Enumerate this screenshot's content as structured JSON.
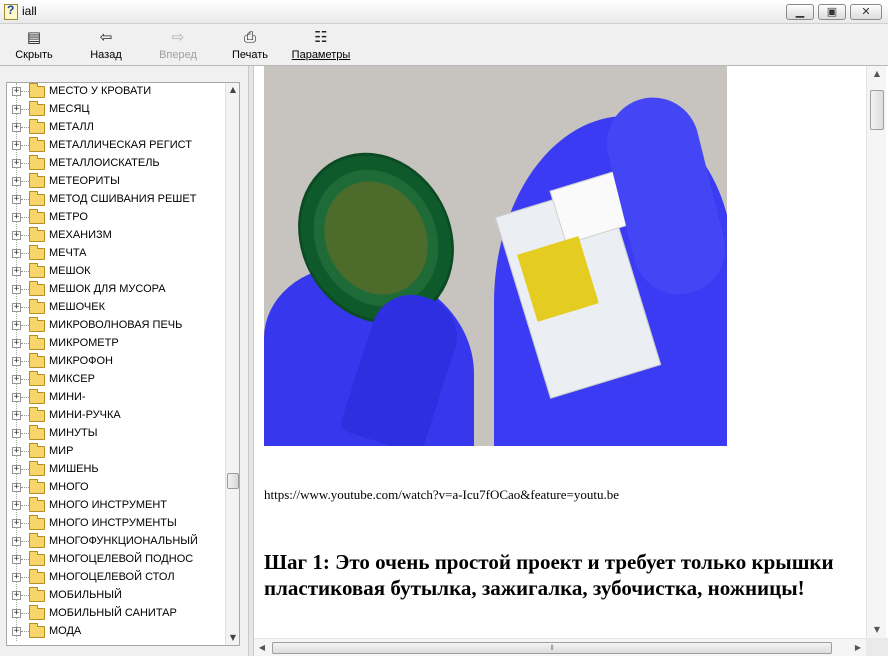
{
  "window": {
    "title": "iall",
    "min_glyph": "▁",
    "max_glyph": "▣",
    "close_glyph": "✕"
  },
  "toolbar": {
    "hide": {
      "label": "Скрыть",
      "icon": "hide-pane-icon",
      "glyph": "▤"
    },
    "back": {
      "label": "Назад",
      "icon": "back-arrow-icon",
      "glyph": "⇦"
    },
    "forward": {
      "label": "Вперед",
      "icon": "forward-arrow-icon",
      "glyph": "⇨",
      "disabled": true
    },
    "print": {
      "label": "Печать",
      "icon": "printer-icon",
      "glyph": "⎙"
    },
    "options": {
      "label": "Параметры",
      "icon": "options-icon",
      "glyph": "☷"
    }
  },
  "tree": {
    "expander_glyph": "+",
    "items": [
      "МЕСТО У КРОВАТИ",
      "МЕСЯЦ",
      "МЕТАЛЛ",
      "МЕТАЛЛИЧЕСКАЯ РЕГИСТ",
      "МЕТАЛЛОИСКАТЕЛЬ",
      "МЕТЕОРИТЫ",
      "МЕТОД СШИВАНИЯ РЕШЕТ",
      "МЕТРО",
      "МЕХАНИЗМ",
      "МЕЧТА",
      "МЕШОК",
      "МЕШОК ДЛЯ МУСОРА",
      "МЕШОЧЕК",
      "МИКРОВОЛНОВАЯ ПЕЧЬ",
      "МИКРОМЕТР",
      "МИКРОФОН",
      "МИКСЕР",
      "МИНИ-",
      "МИНИ-РУЧКА",
      "МИНУТЫ",
      "МИР",
      "МИШЕНЬ",
      "МНОГО",
      "МНОГО ИНСТРУМЕНТ",
      "МНОГО ИНСТРУМЕНТЫ",
      "МНОГОФУНКЦИОНАЛЬНЫЙ",
      "МНОГОЦЕЛЕВОЙ ПОДНОС",
      "МНОГОЦЕЛЕВОЙ СТОЛ",
      "МОБИЛЬНЫЙ",
      "МОБИЛЬНЫЙ САНИТАР",
      "МОДА"
    ]
  },
  "content": {
    "url": "https://www.youtube.com/watch?v=a-Icu7fOCao&feature=youtu.be",
    "heading": "Шаг 1: Это очень простой проект и требует только крышки пластиковая бутылка, зажигалка, зубочистка, ножницы!"
  },
  "scroll": {
    "up_glyph": "▲",
    "down_glyph": "▼",
    "left_glyph": "◀",
    "right_glyph": "▶",
    "grip_glyph": "⦀"
  }
}
